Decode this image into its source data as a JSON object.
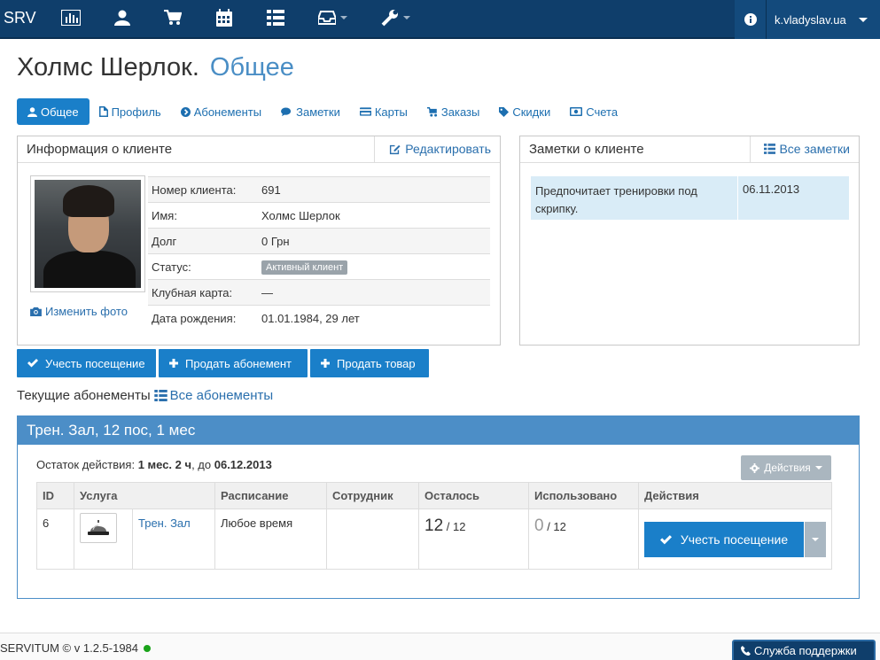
{
  "nav": {
    "brand": "SRV",
    "icons": [
      "stats-icon",
      "user-icon",
      "cart-icon",
      "calendar-icon",
      "list-icon",
      "inbox-icon",
      "wrench-icon"
    ],
    "user": "k.vladyslav.ua"
  },
  "page": {
    "title": "Холмс Шерлок.",
    "subtitle": "Общее"
  },
  "tabs": [
    {
      "label": "Общее",
      "icon": "user-icon",
      "active": true
    },
    {
      "label": "Профиль",
      "icon": "file-icon"
    },
    {
      "label": "Абонементы",
      "icon": "chevron-circle-icon"
    },
    {
      "label": "Заметки",
      "icon": "comments-icon"
    },
    {
      "label": "Карты",
      "icon": "credit-card-icon"
    },
    {
      "label": "Заказы",
      "icon": "cart-icon"
    },
    {
      "label": "Скидки",
      "icon": "tag-icon"
    },
    {
      "label": "Счета",
      "icon": "money-icon"
    }
  ],
  "client_info": {
    "title": "Информация о клиенте",
    "edit": "Редактировать",
    "change_photo": "Изменить фото",
    "rows": [
      {
        "key": "Номер клиента:",
        "value": "691"
      },
      {
        "key": "Имя:",
        "value": "Холмс Шерлок"
      },
      {
        "key": "Долг",
        "value": "0 Грн"
      },
      {
        "key": "Статус:",
        "value": "Активный клиент"
      },
      {
        "key": "Клубная карта:",
        "value": "—"
      },
      {
        "key": "Дата рождения:",
        "value": "01.01.1984, 29 лет"
      }
    ]
  },
  "notes": {
    "title": "Заметки о клиенте",
    "all": "Все заметки",
    "items": [
      {
        "text": "Предпочитает тренировки под скрипку.",
        "date": "06.11.2013"
      }
    ]
  },
  "actions": {
    "visit": "Учесть посещение",
    "sell_sub": "Продать абонемент",
    "sell_item": "Продать товар"
  },
  "current_subs": {
    "label": "Текущие абонементы",
    "all": "Все абонементы"
  },
  "subscription": {
    "title": "Трен. Зал, 12 пос, 1 мес",
    "remain_label": "Остаток действия:",
    "remain_value": "1 мес. 2 ч",
    "until_label": ", до",
    "until_value": "06.12.2013",
    "actions_btn": "Действия",
    "columns": [
      "ID",
      "Услуга",
      "Расписание",
      "Сотрудник",
      "Осталось",
      "Использовано",
      "Действия"
    ],
    "rows": [
      {
        "id": "6",
        "service": "Трен. Зал",
        "schedule": "Любое время",
        "staff": "",
        "left": "12",
        "left_total": "/ 12",
        "used": "0",
        "used_total": "/ 12",
        "action": "Учесть посещение"
      }
    ]
  },
  "footer": {
    "version": "SERVITUM © v 1.2.5-1984",
    "support": "Служба поддержки"
  }
}
